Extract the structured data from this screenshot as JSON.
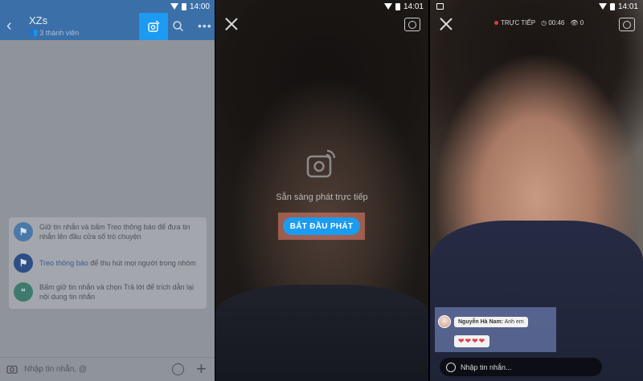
{
  "panel1": {
    "status_time": "14:00",
    "group_name": "XZs",
    "member_count": "3 thành viên",
    "tips": [
      {
        "icon": "pin-icon",
        "text": "Giữ tin nhắn và bấm Treo thông báo để đưa tin nhắn lên đầu cửa sổ trò chuyện"
      },
      {
        "icon": "flag-icon",
        "highlight": "Treo thông báo",
        "text": " để thu hút mọi người trong nhóm"
      },
      {
        "icon": "quote-icon",
        "text": "Bấm giữ tin nhắn và chọn Trả lời để trích dẫn lại nội dung tin nhắn"
      }
    ],
    "input_placeholder": "Nhập tin nhắn, @"
  },
  "panel2": {
    "status_time": "14:01",
    "ready_text": "Sẵn sàng phát trực tiếp",
    "start_button": "BẮT ĐẦU PHÁT"
  },
  "panel3": {
    "status_time": "14:01",
    "live_label": "TRỰC TIẾP",
    "duration": "00:46",
    "viewers": "0",
    "comment_author": "Nguyễn Hà Nam:",
    "comment_text": "Anh em",
    "hearts": "❤❤❤❤",
    "input_placeholder": "Nhập tin nhắn..."
  },
  "colors": {
    "header_blue": "#3b6fa8",
    "accent_blue": "#1a9cf0",
    "live_red": "#e23b3b",
    "heart_red": "#e53c4a"
  }
}
